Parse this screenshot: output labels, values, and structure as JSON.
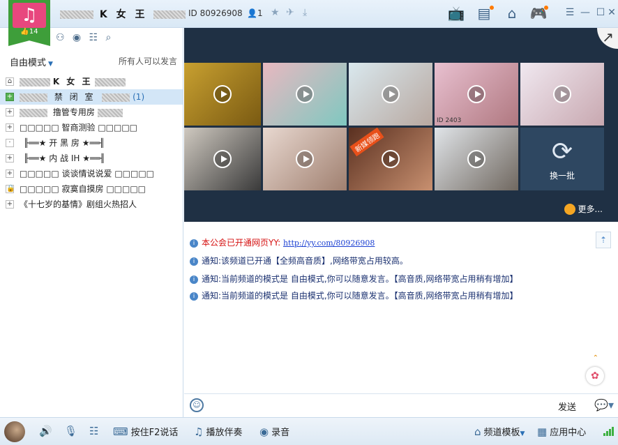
{
  "app": {
    "logo_count": "14",
    "channel_name": "K 女 王",
    "channel_id": "ID 80926908",
    "user_count": "1"
  },
  "left": {
    "mode_label": "自由模式",
    "mode_note": "所有人可以发言",
    "rooms": [
      {
        "label": "K 女 王",
        "expander": "home",
        "count": ""
      },
      {
        "label": "禁 闭 室",
        "expander": "+",
        "count": "(1)"
      },
      {
        "label": "撸管专用房",
        "expander": "+",
        "count": ""
      },
      {
        "label": "□□□□□ 智商测验 □□□□□",
        "expander": "+",
        "count": ""
      },
      {
        "label": "╟══★ 开 黑 房 ★══╢",
        "expander": "·",
        "count": ""
      },
      {
        "label": "╟══★ 内 战 IH ★══╢",
        "expander": "+",
        "count": ""
      },
      {
        "label": "□□□□□ 谈谈情说说爱 □□□□□",
        "expander": "+",
        "count": ""
      },
      {
        "label": "□□□□□ 寂寞自摸房 □□□□□",
        "expander": "lock",
        "count": ""
      },
      {
        "label": "《十七岁的基情》剧组火热招人",
        "expander": "+",
        "count": ""
      }
    ]
  },
  "stream": {
    "thumb_labels": [
      "ID 2403",
      "新媒领跑"
    ],
    "refresh_label": "换一批",
    "more_label": "更多..."
  },
  "chat": {
    "messages": [
      {
        "prefix": "本公会已开通网页YY:",
        "link": "http://yy.com/80926908",
        "rest": ""
      },
      {
        "prefix": "通知:",
        "link": "",
        "rest": "该频道已开通【全频高音质】,网络带宽占用较高。"
      },
      {
        "prefix": "通知:",
        "link": "",
        "rest": "当前频道的模式是 自由模式,你可以随意发言。【高音质,网络带宽占用稍有增加】"
      },
      {
        "prefix": "通知:",
        "link": "",
        "rest": "当前频道的模式是 自由模式,你可以随意发言。【高音质,网络带宽占用稍有增加】"
      }
    ]
  },
  "input": {
    "send_label": "发送"
  },
  "bottom": {
    "push_to_talk": "按住F2说话",
    "play_music": "播放伴奏",
    "record": "录音",
    "channel_template": "频道模板",
    "app_center": "应用中心"
  },
  "colors": {
    "accent": "#2a6fb5",
    "logo_pink": "#e8477e",
    "ribbon_green": "#3e9e3a",
    "stream_bg": "#1f3044"
  }
}
